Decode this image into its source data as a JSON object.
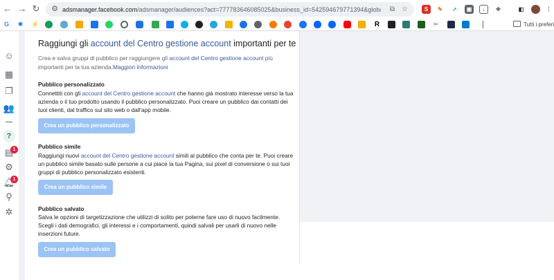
{
  "browser": {
    "url_host": "adsmanager.facebook.com",
    "url_rest": "/adsmanager/audiences?act=777783646085025&business_id=542594679771394&global_scope_i...",
    "bookmarks_all_label": "Tutti i preferiti"
  },
  "sidebar": {
    "help_label": "?",
    "notifications_badge": "1",
    "alerts_badge": "1"
  },
  "main": {
    "title_prefix": "Raggiungi gli ",
    "title_link": "account del Centro gestione account",
    "title_suffix": " importanti per te",
    "intro_text_1": "Crea e salva gruppi di pubblico per raggiungere gli ",
    "intro_link": "account del Centro gestione account",
    "intro_text_2": " più importanti per la tua azienda.",
    "intro_more_link": "Maggiori informazioni",
    "sections": [
      {
        "heading": "Pubblico personalizzato",
        "text_1": "Connettiti con gli ",
        "link": "account del Centro gestione account",
        "text_2": " che hanno già mostrato interesse verso la tua azienda o il tuo prodotto usando il pubblico personalizzato. Puoi creare un pubblico dai contatti dei tuoi clienti, dal traffico sul sito web o dall'app mobile.",
        "button": "Crea un pubblico personalizzato"
      },
      {
        "heading": "Pubblico simile",
        "text_1": "Raggiungi nuovi ",
        "link": "account del Centro gestione account",
        "text_2": " simili al pubblico che conta per te. Puoi creare un pubblico simile basato sulle persone a cui piace la tua Pagina, sui pixel di conversione o sui tuoi gruppi di pubblico personalizzato esistenti.",
        "button": "Crea un pubblico simile"
      },
      {
        "heading": "Pubblico salvato",
        "text_1": "Salva le opzioni di targetizzazione che utilizzi di solito per poterne fare uso di nuovo facilmente. Scegli i dati demografici, gli interessi e i comportamenti, quindi salvali per usarli di nuovo nelle inserzioni future.",
        "link": "",
        "text_2": "",
        "button": "Crea un pubblico salvato"
      }
    ]
  },
  "colors": {
    "link": "#385898",
    "button_disabled": "#9cc3f5",
    "background_gray": "#f0f2f5",
    "badge": "#e41e3f"
  }
}
